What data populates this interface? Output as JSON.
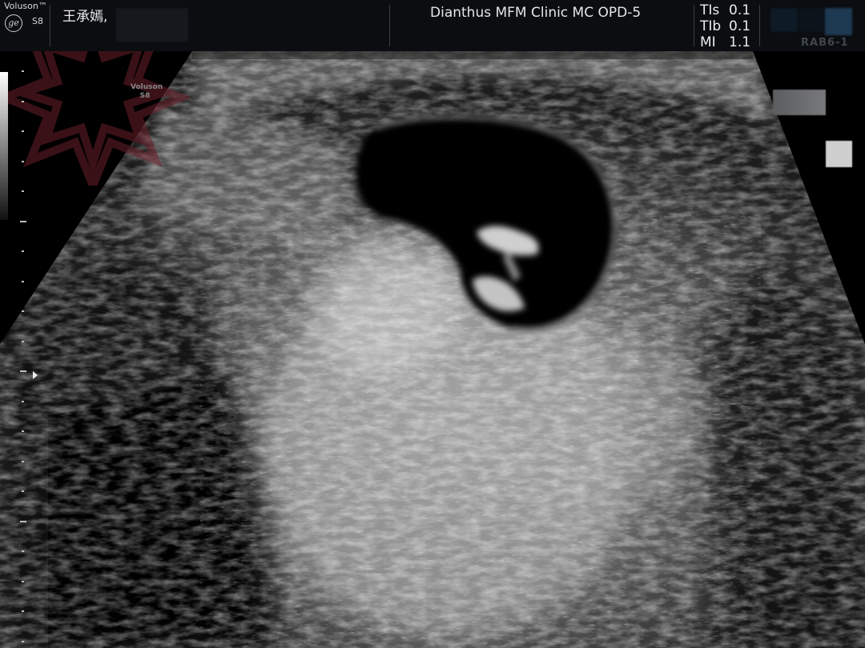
{
  "header": {
    "brand_line": "Voluson™",
    "brand_model": "S8",
    "logo_glyph": "ge",
    "patient_name": "王承嫣,",
    "clinic": "Dianthus MFM Clinic MC OPD-5",
    "safety": [
      {
        "label": "TIs",
        "value": "0.1"
      },
      {
        "label": "TIb",
        "value": "0.1"
      },
      {
        "label": "MI",
        "value": "1.1"
      }
    ],
    "probe_label": "RAB6-1"
  },
  "watermark": {
    "line1": "Voluson",
    "line2": "S8"
  },
  "icons": {
    "logo": "ge-logo-icon",
    "focus": "focus-marker-icon",
    "watermark": "star-logo-icon"
  },
  "colors": {
    "background": "#000000",
    "header": "#0b0d10",
    "watermark": "#6b1f2a",
    "swatch_blue": "#1e3a52"
  }
}
